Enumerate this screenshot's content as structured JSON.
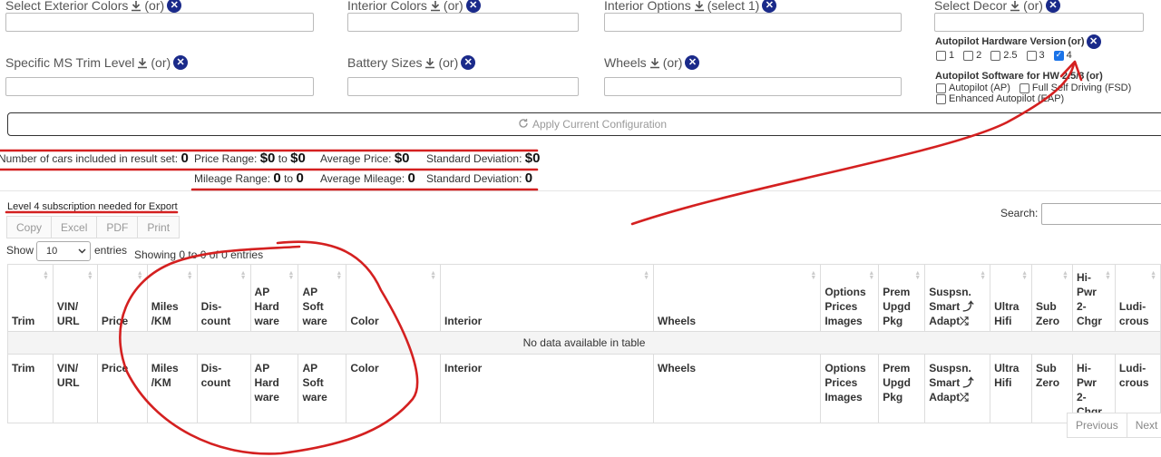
{
  "filters": {
    "exterior_label": "Select Exterior Colors",
    "interior_label": "Interior Colors",
    "options_label": "Interior Options",
    "options_suffix": "(select 1)",
    "decor_label": "Select Decor",
    "trim_label": "Specific MS Trim Level",
    "battery_label": "Battery Sizes",
    "wheels_label": "Wheels",
    "or": "(or)"
  },
  "autopilot": {
    "hw_title": "Autopilot Hardware Version",
    "hw_or": "(or)",
    "hw_options": [
      "1",
      "2",
      "2.5",
      "3",
      "4"
    ],
    "hw_checked": "4",
    "sw_title": "Autopilot Software for HW 2.5/3",
    "sw_or": "(or)",
    "sw_options": [
      "Autopilot (AP)",
      "Full Self Driving (FSD)",
      "Enhanced Autopilot (EAP)"
    ]
  },
  "apply_label": "Apply Current Configuration",
  "stats": {
    "count_label": "Number of cars included in result set:",
    "count_value": "0",
    "price_range_label": "Price Range:",
    "price_min": "$0",
    "to": "to",
    "price_max": "$0",
    "avg_price_label": "Average Price:",
    "avg_price": "$0",
    "std_label": "Standard Deviation:",
    "std_price": "$0",
    "mileage_range_label": "Mileage Range:",
    "mileage_min": "0",
    "mileage_max": "0",
    "avg_mileage_label": "Average Mileage:",
    "avg_mileage": "0",
    "std_mileage": "0"
  },
  "export_note": "Level 4 subscription needed for Export",
  "export_buttons": [
    "Copy",
    "Excel",
    "PDF",
    "Print"
  ],
  "length": {
    "show": "Show",
    "value": "10",
    "entries": "entries"
  },
  "info": "Showing 0 to 0 of 0 entries",
  "search_label": "Search:",
  "table": {
    "headers": [
      [
        "Trim"
      ],
      [
        "VIN/",
        "URL"
      ],
      [
        "Price"
      ],
      [
        "Miles",
        "/KM"
      ],
      [
        "Dis-",
        "count"
      ],
      [
        "AP",
        "Hard",
        "ware"
      ],
      [
        "AP",
        "Soft",
        "ware"
      ],
      [
        "Color"
      ],
      [
        "Interior"
      ],
      [
        "Wheels"
      ],
      [
        "Options",
        "Prices",
        "Images"
      ],
      [
        "Prem",
        "Upgd",
        "Pkg"
      ],
      [
        "Suspsn.",
        "Smart ⤴",
        "Adapt⤮"
      ],
      [
        "Ultra",
        "Hifi"
      ],
      [
        "Sub",
        "Zero"
      ],
      [
        "Hi-",
        "Pwr",
        "2-",
        "Chgr"
      ],
      [
        "Ludi-",
        "crous"
      ]
    ],
    "footers": [
      [
        "Trim"
      ],
      [
        "VIN/",
        "URL"
      ],
      [
        "Price"
      ],
      [
        "Miles",
        "/KM"
      ],
      [
        "Dis-",
        "count"
      ],
      [
        "AP",
        "Hard",
        "ware"
      ],
      [
        "AP",
        "Soft",
        "ware"
      ],
      [
        "Color"
      ],
      [
        "Interior"
      ],
      [
        "Wheels"
      ],
      [
        "Options",
        "Prices",
        "Images"
      ],
      [
        "Prem",
        "Upgd",
        "Pkg"
      ],
      [
        "Suspsn.",
        "Smart ⤴",
        "Adapt⤮"
      ],
      [
        "Ultra",
        "Hifi"
      ],
      [
        "Sub",
        "Zero"
      ],
      [
        "Hi-Pwr",
        "2-Chgr"
      ],
      [
        "Ludi-",
        "crous"
      ]
    ],
    "empty": "No data available in table"
  },
  "pagination": {
    "previous": "Previous",
    "next": "Next"
  },
  "colors": {
    "annotation": "#d42020",
    "clear_icon": "#1a2a8a",
    "checkbox": "#1a73e8"
  },
  "icons": [
    "download-icon",
    "clear-circle-icon",
    "refresh-icon",
    "sort-icon",
    "chevron-down-icon"
  ]
}
